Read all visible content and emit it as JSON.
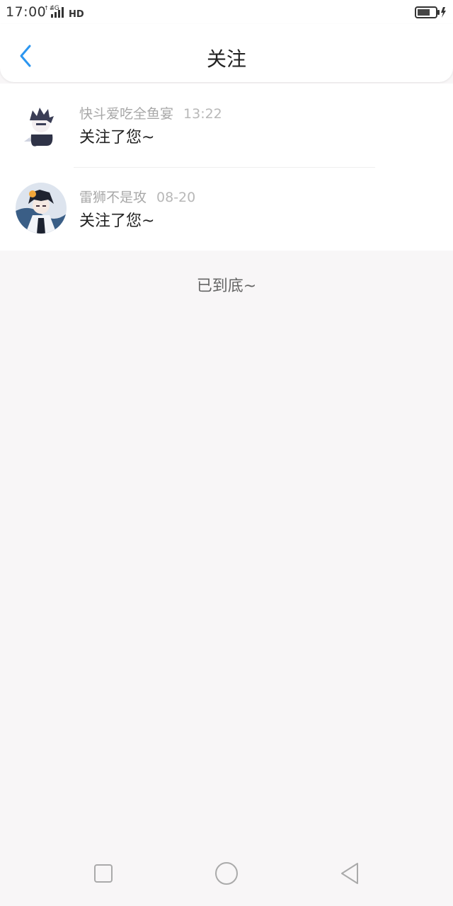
{
  "status_bar": {
    "time": "17:00",
    "network": "4G",
    "hd": "HD"
  },
  "header": {
    "title": "关注",
    "accent_color": "#2b96f0"
  },
  "notifications": [
    {
      "username": "快斗爱吃全鱼宴",
      "time": "13:22",
      "message": "关注了您~"
    },
    {
      "username": "雷狮不是攻",
      "time": "08-20",
      "message": "关注了您~"
    }
  ],
  "list_footer": "已到底~",
  "nav": {
    "recent_icon": "square-icon",
    "home_icon": "circle-icon",
    "back_icon": "triangle-back-icon"
  }
}
